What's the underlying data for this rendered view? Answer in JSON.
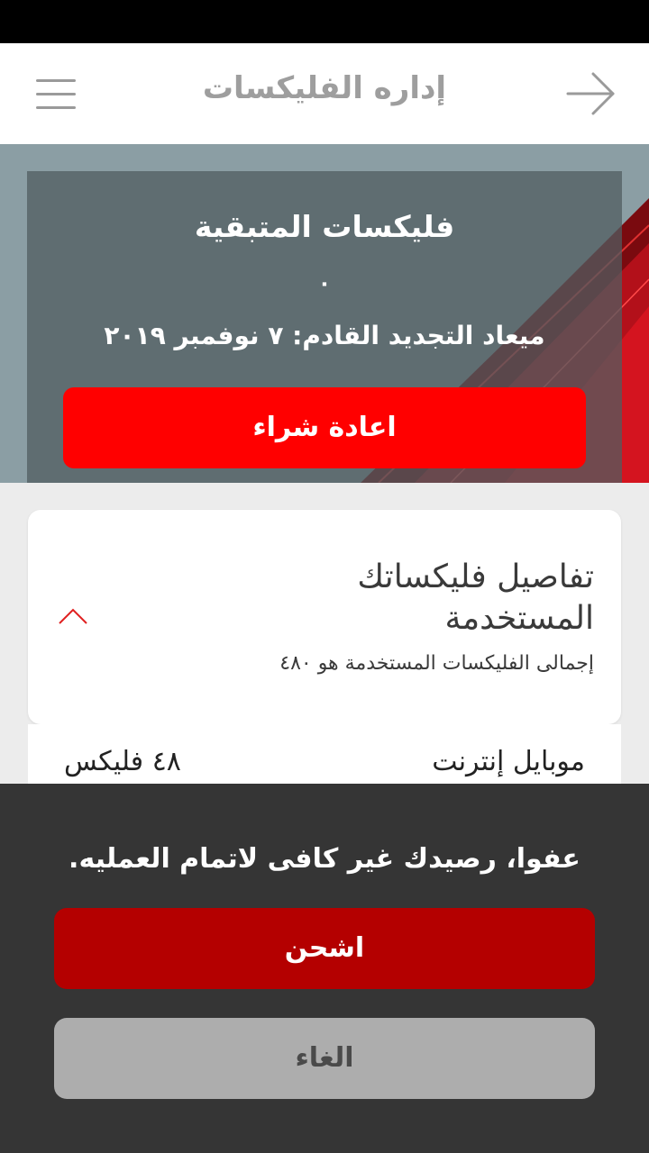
{
  "header": {
    "title": "إداره الفليكسات",
    "menu_icon": "hamburger-menu-icon",
    "back_icon": "arrow-right-icon"
  },
  "hero": {
    "remaining_label": "فليكسات المتبقية",
    "remaining_value": "٠",
    "renewal_text": "ميعاد التجديد القادم: ٧ نوفمبر ٢٠١٩",
    "rebuy_label": "اعادة شراء"
  },
  "details": {
    "heading": "تفاصيل فليكساتك المستخدمة",
    "total_text": "إجمالى الفليكسات المستخدمة هو ٤٨٠",
    "toggle_icon": "chevron-up-icon"
  },
  "usage": [
    {
      "type": "موبايل إنترنت",
      "amount": "٤٨ فليكس"
    }
  ],
  "dialog": {
    "message": "عفوا، رصيدك غير كافى لاتمام العمليه.",
    "recharge_label": "اشحن",
    "cancel_label": "الغاء"
  },
  "colors": {
    "primary_red": "#ff0000",
    "dark_red": "#b40000",
    "dialog_bg": "#353535",
    "cancel_gray": "#adadad"
  }
}
